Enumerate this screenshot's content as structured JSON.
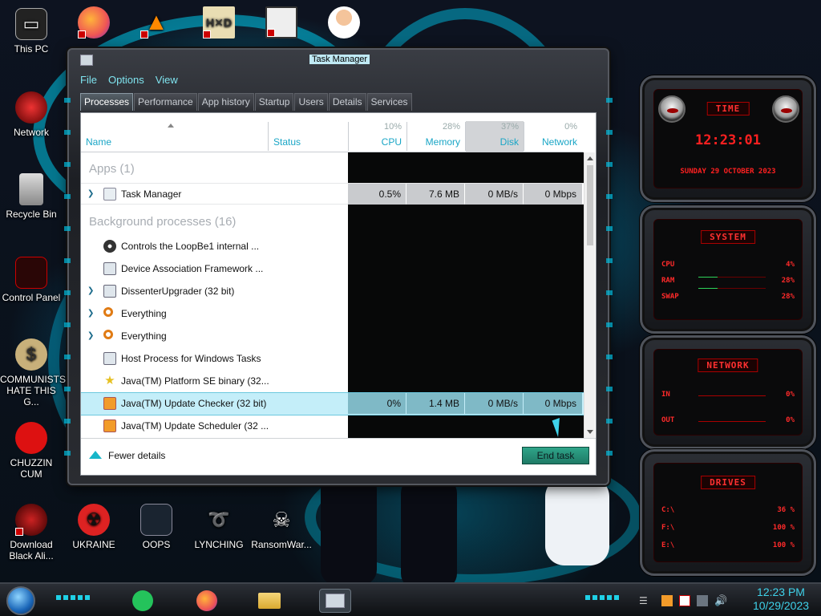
{
  "desktop": {
    "icons": [
      {
        "label": "This PC",
        "icon": "computer-icon"
      },
      {
        "label": "Network",
        "icon": "network-icon"
      },
      {
        "label": "Recycle Bin",
        "icon": "recycle-bin-icon"
      },
      {
        "label": "Control Panel",
        "icon": "control-panel-icon"
      },
      {
        "label": "COMMUNISTS HATE THIS G...",
        "icon": "money-bag-icon"
      },
      {
        "label": "CHUZZIN CUM",
        "icon": "red-creature-icon"
      },
      {
        "label": "Download Black Ali...",
        "icon": "alien-icon"
      },
      {
        "label": "UKRAINE",
        "icon": "radiation-icon"
      },
      {
        "label": "OOPS",
        "icon": "mirror-icon"
      },
      {
        "label": "LYNCHING",
        "icon": "noose-icon"
      },
      {
        "label": "RansomWar...",
        "icon": "skull-icon"
      }
    ],
    "top_icons": [
      "firefox-icon",
      "vlc-icon",
      "xd-app-icon",
      "maze-app-icon",
      "doctor-icon"
    ]
  },
  "task_manager": {
    "title": "Task Manager",
    "menu": [
      "File",
      "Options",
      "View"
    ],
    "tabs": [
      "Processes",
      "Performance",
      "App history",
      "Startup",
      "Users",
      "Details",
      "Services"
    ],
    "active_tab": "Processes",
    "columns": {
      "name": "Name",
      "status": "Status",
      "cpu": {
        "label": "CPU",
        "pct": "10%"
      },
      "memory": {
        "label": "Memory",
        "pct": "28%"
      },
      "disk": {
        "label": "Disk",
        "pct": "37%"
      },
      "network": {
        "label": "Network",
        "pct": "0%"
      }
    },
    "apps_header": "Apps (1)",
    "apps": [
      {
        "name": "Task Manager",
        "cpu": "0.5%",
        "memory": "7.6 MB",
        "disk": "0 MB/s",
        "network": "0 Mbps"
      }
    ],
    "bg_header": "Background processes (16)",
    "background": [
      {
        "name": "Controls the LoopBe1 internal ...",
        "expand": false,
        "icon": "mouse-icon"
      },
      {
        "name": "Device Association Framework ...",
        "expand": false,
        "icon": "window-app-icon"
      },
      {
        "name": "DissenterUpgrader (32 bit)",
        "expand": true,
        "icon": "window-app-icon"
      },
      {
        "name": "Everything",
        "expand": true,
        "icon": "magnifier-icon"
      },
      {
        "name": "Everything",
        "expand": true,
        "icon": "magnifier-icon"
      },
      {
        "name": "Host Process for Windows Tasks",
        "expand": false,
        "icon": "window-app-icon"
      },
      {
        "name": "Java(TM) Platform SE binary (32...",
        "expand": false,
        "icon": "java-star-icon"
      },
      {
        "name": "Java(TM) Update Checker (32 bit)",
        "expand": false,
        "icon": "java-icon",
        "selected": true,
        "cpu": "0%",
        "memory": "1.4 MB",
        "disk": "0 MB/s",
        "network": "0 Mbps"
      },
      {
        "name": "Java(TM) Update Scheduler (32 ...",
        "expand": false,
        "icon": "java-icon"
      }
    ],
    "fewer_details": "Fewer details",
    "end_task": "End task"
  },
  "gadgets": {
    "time": {
      "title": "TIME",
      "clock": "12:23:01",
      "date": "SUNDAY 29 OCTOBER 2023"
    },
    "system": {
      "title": "SYSTEM",
      "rows": [
        {
          "label": "CPU",
          "value": "4%"
        },
        {
          "label": "RAM",
          "value": "28%"
        },
        {
          "label": "SWAP",
          "value": "28%"
        }
      ]
    },
    "network": {
      "title": "NETWORK",
      "rows": [
        {
          "label": "IN",
          "value": "0%"
        },
        {
          "label": "OUT",
          "value": "0%"
        }
      ]
    },
    "drives": {
      "title": "DRIVES",
      "rows": [
        {
          "label": "C:\\",
          "value": "36 %"
        },
        {
          "label": "F:\\",
          "value": "100 %"
        },
        {
          "label": "E:\\",
          "value": "100 %"
        }
      ]
    }
  },
  "taskbar": {
    "apps": [
      "start-orb-icon",
      "notes-app-icon",
      "firefox-icon",
      "file-explorer-icon",
      "task-manager-icon"
    ],
    "time": "12:23 PM",
    "date": "10/29/2023",
    "accent": "#1fd0e6"
  }
}
